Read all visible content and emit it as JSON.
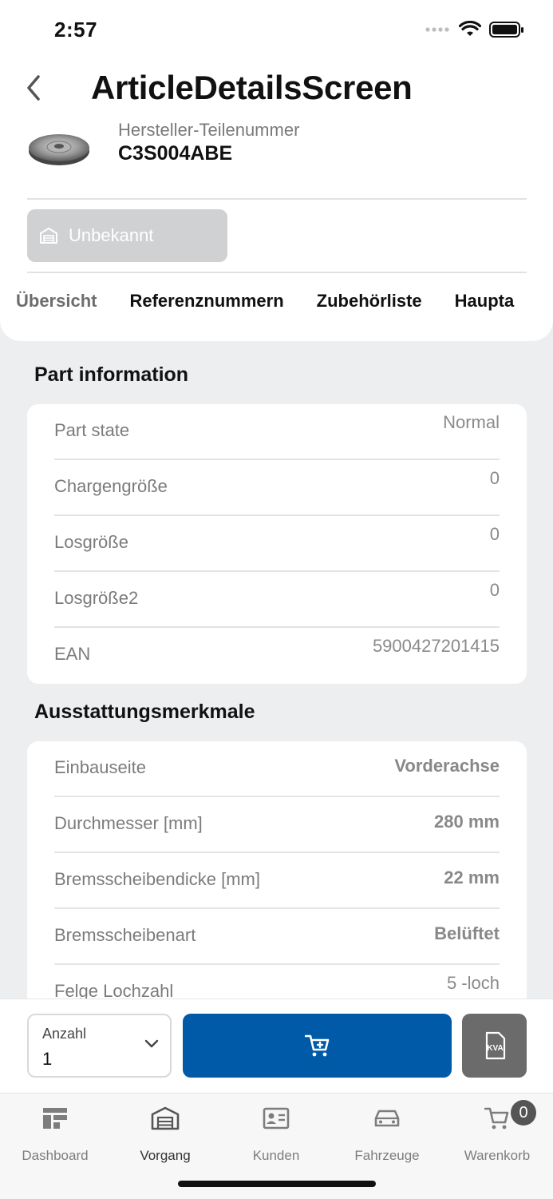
{
  "status_bar": {
    "time": "2:57"
  },
  "header": {
    "title": "ArticleDetailsScreen",
    "subtitle": "Hersteller-Teilenummer",
    "part_number": "C3S004ABE"
  },
  "stock": {
    "label": "Unbekannt"
  },
  "tabs": [
    {
      "label": "Übersicht",
      "active": true
    },
    {
      "label": "Referenznummern"
    },
    {
      "label": "Zubehörliste"
    },
    {
      "label": "Haupta"
    }
  ],
  "part_information": {
    "title": "Part information",
    "rows": [
      {
        "label": "Part state",
        "value": "Normal"
      },
      {
        "label": "Chargengröße",
        "value": "0"
      },
      {
        "label": "Losgröße",
        "value": "0"
      },
      {
        "label": "Losgröße2",
        "value": "0"
      },
      {
        "label": "EAN",
        "value": "5900427201415"
      }
    ]
  },
  "features": {
    "title": "Ausstattungsmerkmale",
    "rows": [
      {
        "label": "Einbauseite",
        "value": "Vorderachse"
      },
      {
        "label": "Durchmesser [mm]",
        "value": "280 mm"
      },
      {
        "label": "Bremsscheibendicke [mm]",
        "value": "22 mm"
      },
      {
        "label": "Bremsscheibenart",
        "value": "Belüftet"
      },
      {
        "label": "Felge Lochzahl",
        "value": "5 -loch"
      }
    ]
  },
  "action_bar": {
    "quantity_label": "Anzahl",
    "quantity_value": "1",
    "kva_label": "KVA"
  },
  "tabbar": {
    "items": [
      {
        "label": "Dashboard"
      },
      {
        "label": "Vorgang",
        "active": true
      },
      {
        "label": "Kunden"
      },
      {
        "label": "Fahrzeuge"
      },
      {
        "label": "Warenkorb",
        "badge": "0"
      }
    ]
  },
  "colors": {
    "primary": "#005aa8",
    "kva": "#6b6b6b",
    "background": "#eceeef"
  }
}
